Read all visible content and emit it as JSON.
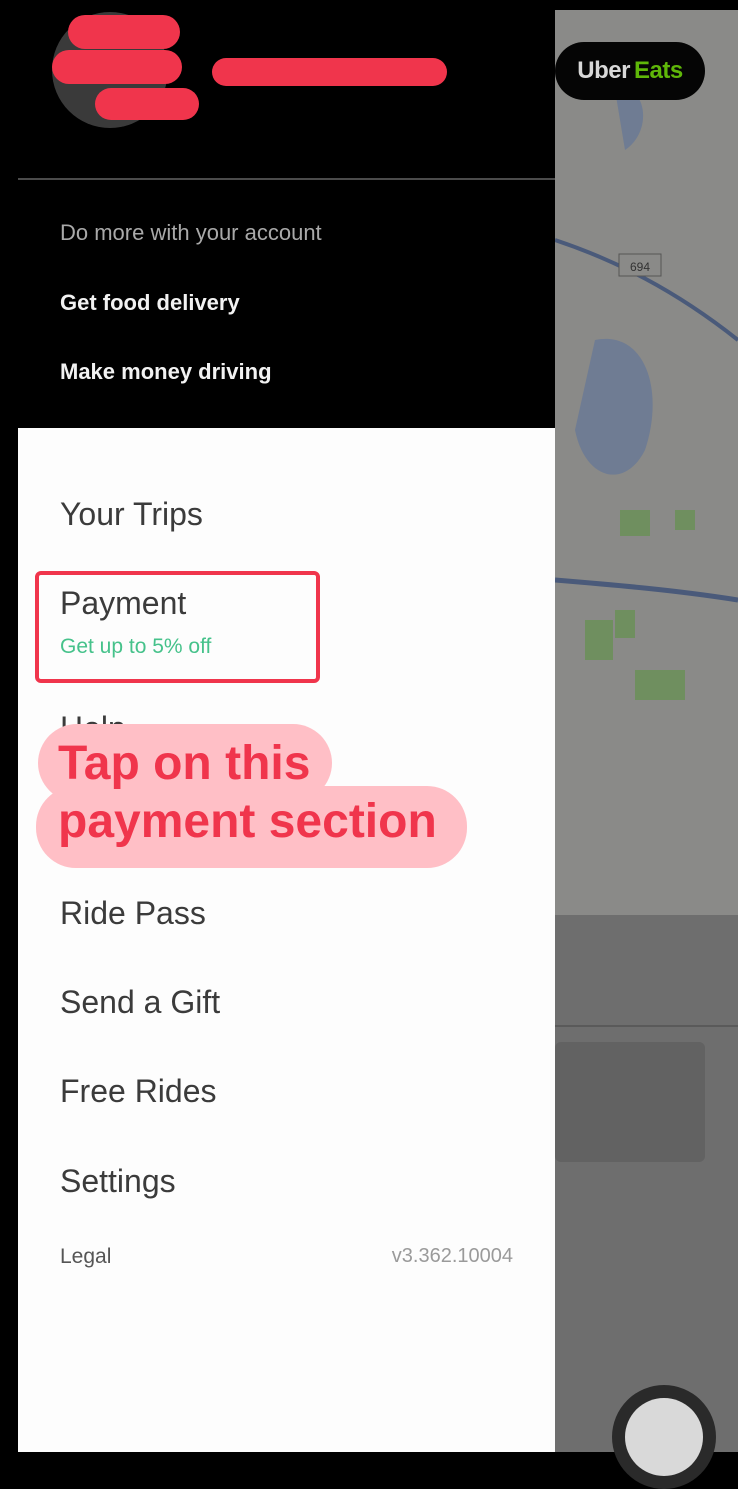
{
  "header": {
    "do_more": "Do more with your account",
    "links": [
      "Get food delivery",
      "Make money driving"
    ]
  },
  "menu": {
    "your_trips": "Your Trips",
    "payment": "Payment",
    "payment_promo": "Get up to 5% off",
    "help_partial": "Help",
    "ride_pass": "Ride Pass",
    "send_gift": "Send a Gift",
    "free_rides": "Free Rides",
    "settings": "Settings",
    "legal": "Legal",
    "version": "v3.362.10004"
  },
  "map": {
    "eats_brand_uber": "Uber",
    "eats_brand_eats": "Eats",
    "highway_label": "694"
  },
  "annotation": {
    "line1": "Tap on this",
    "line2": "payment section"
  },
  "colors": {
    "accent_red": "#f0354c",
    "callout_bg": "#ffbfc6",
    "promo_green": "#46c28b",
    "eats_green": "#5fb709"
  }
}
